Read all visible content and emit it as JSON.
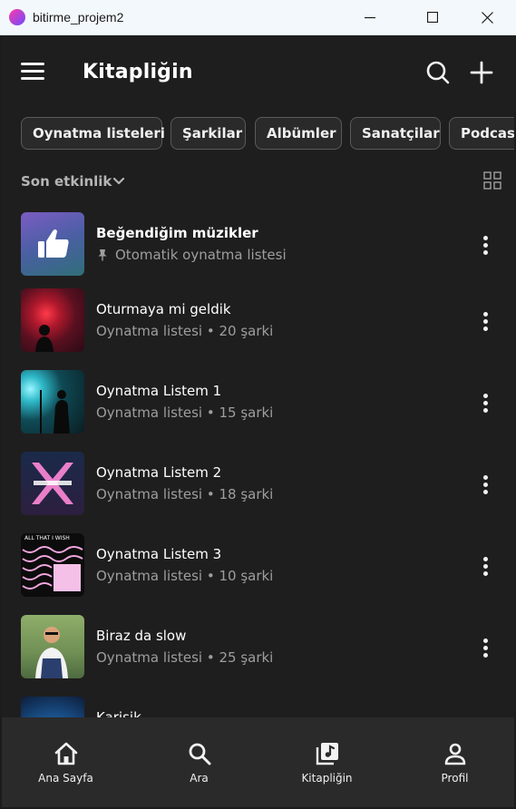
{
  "window": {
    "title": "bitirme_projem2"
  },
  "header": {
    "title": "Kitapliğin"
  },
  "filters": [
    "Oynatma listeleri",
    "Şarkilar",
    "Albümler",
    "Sanatçilar",
    "Podcast"
  ],
  "sort": {
    "label": "Son etkinlik"
  },
  "items": [
    {
      "title": "Beğendiğim müzikler",
      "subtitle": "Otomatik oynatma listesi",
      "pinned": true,
      "cover": "liked-music"
    },
    {
      "title": "Oturmaya mi geldik",
      "subtitle": "Oynatma listesi • 20 şarki",
      "cover": "red-silhouette"
    },
    {
      "title": "Oynatma Listem 1",
      "subtitle": "Oynatma listesi • 15 şarki",
      "cover": "stage-singer"
    },
    {
      "title": "Oynatma Listem 2",
      "subtitle": "Oynatma listesi • 18 şarki",
      "cover": "neon-x"
    },
    {
      "title": "Oynatma Listem 3",
      "subtitle": "Oynatma listesi • 10 şarki",
      "cover": "all-that-i-wish",
      "cover_text": "ALL THAT I WISH"
    },
    {
      "title": "Biraz da slow",
      "subtitle": "Oynatma listesi • 25 şarki",
      "cover": "man-overalls"
    },
    {
      "title": "Karisik",
      "subtitle": "",
      "cover": "concert-lights"
    }
  ],
  "bottom_nav": [
    {
      "label": "Ana Sayfa",
      "icon": "home-icon"
    },
    {
      "label": "Ara",
      "icon": "search-icon"
    },
    {
      "label": "Kitapliğin",
      "icon": "library-icon"
    },
    {
      "label": "Profil",
      "icon": "person-icon"
    }
  ],
  "colors": {
    "background": "#1f1e1e",
    "nav": "#2b2a2a",
    "chip_border": "#5a5a5a",
    "subtitle": "#9e9e9e"
  }
}
